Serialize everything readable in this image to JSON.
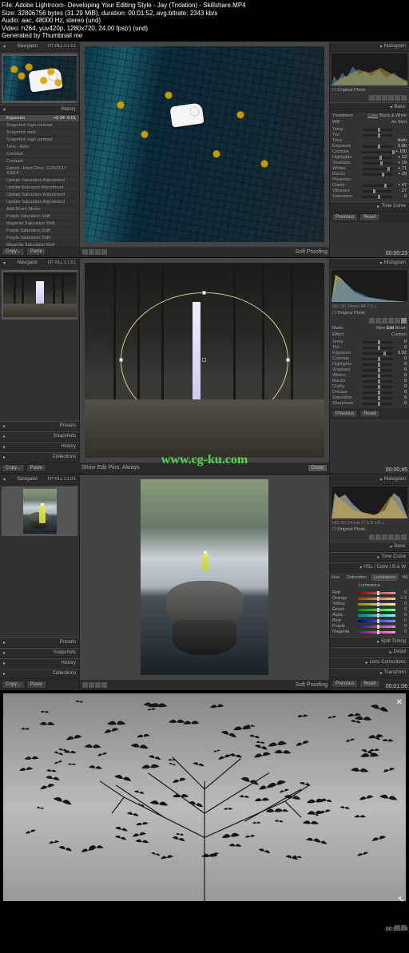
{
  "meta": {
    "l1": "File: Adobe Lightroom- Developing Your Editing Style - Jay (Trxlation) - Skillshare.MP4",
    "l2": "Size: 32806756 bytes (31.29 MiB), duration: 00:01:52, avg.bitrate: 2343 kb/s",
    "l3": "Audio: aac, 48000 Hz, stereo (und)",
    "l4": "Video: h264, yuv420p, 1280x720, 24.00 fps(r) (und)",
    "l5": "Generated by Thumbnail me"
  },
  "watermark": "www.cg-ku.com",
  "common": {
    "navigator": "Navigator",
    "histogram": "Histogram",
    "presets": "Presets",
    "snapshots": "Snapshots",
    "history": "History",
    "collections": "Collections",
    "copy": "Copy...",
    "paste": "Paste",
    "previous": "Previous",
    "reset": "Reset",
    "softproof": "Soft Proofing",
    "fit": "FIT  FILL  1:1  3:1",
    "original": "Original Photo"
  },
  "frame1": {
    "timestamp": "00:00:23",
    "history_sel": "Exposure",
    "history_sel_val": "+0.94  -0.01",
    "history": [
      "Snapshot: high contrast",
      "Snapshot: dark",
      "Snapshot: high contrast",
      "Tone - Auto",
      "Contrast",
      "Contrast",
      "Export - Hard Drive (1/29/2017 4:50:4…",
      "Update Saturation Adjustment",
      "Update Exposure Adjustment",
      "Update Saturation Adjustment",
      "Update Saturation Adjustment",
      "Add Brush Stroke",
      "Purple Saturation Shift",
      "Magenta Saturation Shift",
      "Purple Saturation Shift",
      "Purple Saturation Shift",
      "Magenta Saturation Shift"
    ],
    "basic": "Basic",
    "tone_curve": "Tone Curve",
    "treatment": "Treatment:",
    "color": "Color",
    "bw": "Black & White",
    "wb": "WB:",
    "asshot": "As Shot",
    "sliders": [
      {
        "lbl": "Temp",
        "val": "",
        "pos": 50
      },
      {
        "lbl": "Tint",
        "val": "",
        "pos": 50
      },
      {
        "lbl": "Tone",
        "val": "Auto",
        "pos": -1
      },
      {
        "lbl": "Exposure",
        "val": "0.00",
        "pos": 50
      },
      {
        "lbl": "Contrast",
        "val": "+ 100",
        "pos": 100
      },
      {
        "lbl": "Highlights",
        "val": "+ 13",
        "pos": 56
      },
      {
        "lbl": "Shadows",
        "val": "+ 19",
        "pos": 59
      },
      {
        "lbl": "Whites",
        "val": "+ 71",
        "pos": 85
      },
      {
        "lbl": "Blacks",
        "val": "+ 29",
        "pos": 64
      },
      {
        "lbl": "Presence",
        "val": "",
        "pos": -1
      },
      {
        "lbl": "Clarity",
        "val": "+ 47",
        "pos": 73
      },
      {
        "lbl": "Vibrance",
        "val": "- 27",
        "pos": 36
      },
      {
        "lbl": "Saturation",
        "val": "0",
        "pos": 50
      }
    ]
  },
  "frame2": {
    "timestamp": "00:00:45",
    "exif": "ISO 50  24mm  f/4  7.5 s",
    "mask": "Mask:",
    "new": "New",
    "edit": "Edit",
    "brush": "Brush",
    "effect": "Effect:",
    "custom": "Custom",
    "close": "Close",
    "sliders": [
      {
        "lbl": "Temp",
        "val": "0",
        "pos": 50
      },
      {
        "lbl": "Tint",
        "val": "0",
        "pos": 50
      },
      {
        "lbl": "Exposure",
        "val": "0.92",
        "pos": 70
      },
      {
        "lbl": "Contrast",
        "val": "0",
        "pos": 50
      },
      {
        "lbl": "Highlights",
        "val": "0",
        "pos": 50
      },
      {
        "lbl": "Shadows",
        "val": "0",
        "pos": 50
      },
      {
        "lbl": "Whites",
        "val": "0",
        "pos": 50
      },
      {
        "lbl": "Blacks",
        "val": "0",
        "pos": 50
      },
      {
        "lbl": "Clarity",
        "val": "0",
        "pos": 50
      },
      {
        "lbl": "Dehaze",
        "val": "0",
        "pos": 50
      },
      {
        "lbl": "Saturation",
        "val": "0",
        "pos": 50
      },
      {
        "lbl": "Sharpness",
        "val": "0",
        "pos": 50
      }
    ],
    "bottombar": "Show Edit Pins: Always"
  },
  "frame3": {
    "timestamp": "00:01:06",
    "exif": "ISO 50  24 mm  f / 1.8  1/8 s",
    "basic": "Basic",
    "tone_curve": "Tone Curve",
    "hsl": "HSL / Color / B & W",
    "hue": "Hue",
    "sat": "Saturation",
    "lum": "Luminance",
    "all": "All",
    "luminance_lbl": "Luminance",
    "split": "Split Toning",
    "detail": "Detail",
    "lens": "Lens Corrections",
    "transform": "Transform",
    "channels": [
      {
        "lbl": "Red",
        "val": "0",
        "c1": "#800",
        "c2": "#f88"
      },
      {
        "lbl": "Orange",
        "val": "+ 3",
        "c1": "#840",
        "c2": "#fc8"
      },
      {
        "lbl": "Yellow",
        "val": "0",
        "c1": "#880",
        "c2": "#ff8"
      },
      {
        "lbl": "Green",
        "val": "0",
        "c1": "#080",
        "c2": "#8f8"
      },
      {
        "lbl": "Aqua",
        "val": "0",
        "c1": "#088",
        "c2": "#8ff"
      },
      {
        "lbl": "Blue",
        "val": "0",
        "c1": "#008",
        "c2": "#88f"
      },
      {
        "lbl": "Purple",
        "val": "0",
        "c1": "#408",
        "c2": "#c8f"
      },
      {
        "lbl": "Magenta",
        "val": "0",
        "c1": "#808",
        "c2": "#f8f"
      }
    ]
  },
  "frame4": {
    "timestamp": "00:01:29"
  }
}
